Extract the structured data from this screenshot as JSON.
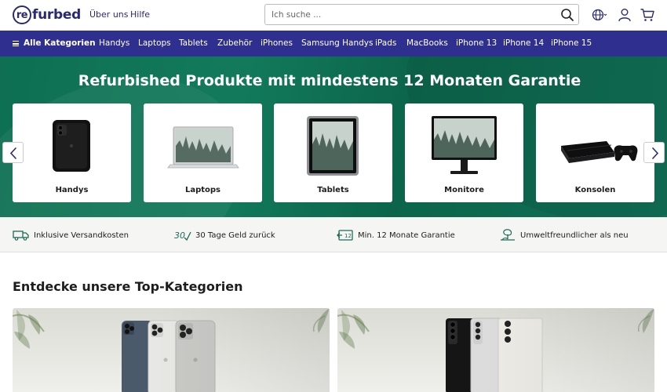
{
  "header": {
    "logo_prefix": "re",
    "logo_suffix": "furbed",
    "links": [
      "Über uns",
      "Hilfe"
    ],
    "search_placeholder": "Ich suche ...",
    "icons": [
      "search-icon",
      "globe-icon",
      "user-icon",
      "cart-icon"
    ]
  },
  "nav": {
    "all_categories": "Alle Kategorien",
    "items": [
      "Handys",
      "Laptops",
      "Tablets",
      "Zubehör",
      "iPhones",
      "Samsung Handys",
      "iPads",
      "MacBooks",
      "iPhone 13",
      "iPhone 14",
      "iPhone 15"
    ]
  },
  "hero": {
    "title": "Refurbished Produkte mit mindestens 12 Monaten Garantie",
    "cards": [
      {
        "label": "Handys",
        "icon": "phone-image"
      },
      {
        "label": "Laptops",
        "icon": "laptop-image"
      },
      {
        "label": "Tablets",
        "icon": "tablet-image"
      },
      {
        "label": "Monitore",
        "icon": "monitor-image"
      },
      {
        "label": "Konsolen",
        "icon": "console-image"
      }
    ]
  },
  "benefits": [
    {
      "text": "Inklusive Versandkosten",
      "icon": "truck-icon"
    },
    {
      "text": "30 Tage Geld zurück",
      "icon": "money-back-icon"
    },
    {
      "text": "Min. 12 Monate Garantie",
      "icon": "warranty-icon"
    },
    {
      "text": "Umweltfreundlicher als neu",
      "icon": "eco-icon"
    }
  ],
  "top_categories": {
    "title": "Entdecke unsere Top-Kategorien"
  },
  "colors": {
    "brand": "#2a2a73",
    "nav_bg": "#2f2f8f",
    "hero_bg": "#0e6f52",
    "benefit_icon": "#1b6b57"
  }
}
